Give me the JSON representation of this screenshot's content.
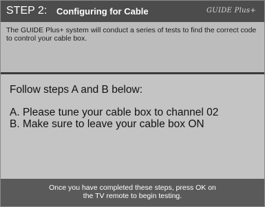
{
  "header": {
    "step_label": "STEP 2:",
    "title": "Configuring for Cable",
    "logo_text": "GUIDE Plus+"
  },
  "intro": {
    "text": "The GUIDE Plus+ system will conduct a series of tests to find the correct code to control your cable box."
  },
  "instructions": {
    "heading": "Follow steps A and B below:",
    "steps": [
      "A. Please tune your cable box to channel 02",
      "B. Make sure to leave your cable box ON"
    ]
  },
  "footer": {
    "line1": "Once you have completed these steps, press OK on",
    "line2": "the TV remote to begin testing."
  },
  "colors": {
    "header_bg": "#4c4c4c",
    "upper_panel_bg": "#bcbcbc",
    "lower_panel_bg": "#c4c4c4",
    "divider": "#3a3a3a",
    "footer_bg": "#5a5a5a"
  }
}
